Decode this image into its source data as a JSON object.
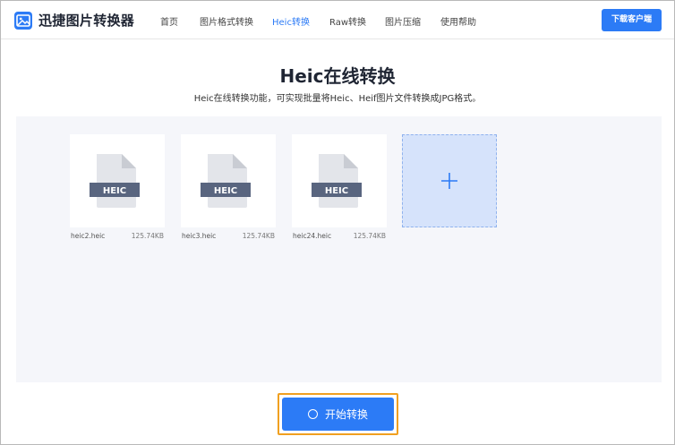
{
  "app": {
    "logo_text": "迅捷图片转换器",
    "brand_color": "#2c7bf6"
  },
  "nav": {
    "items": [
      {
        "label": "首页",
        "active": false
      },
      {
        "label": "图片格式转换",
        "active": false
      },
      {
        "label": "Heic转换",
        "active": true
      },
      {
        "label": "Raw转换",
        "active": false
      },
      {
        "label": "图片压缩",
        "active": false
      },
      {
        "label": "使用帮助",
        "active": false
      }
    ],
    "download_button": "下载客户端"
  },
  "page": {
    "title": "Heic在线转换",
    "subtitle": "Heic在线转换功能，可实现批量将Heic、Heif图片文件转换成JPG格式。"
  },
  "files": [
    {
      "name": "heic2.heic",
      "size": "125.74KB",
      "badge": "HEIC"
    },
    {
      "name": "heic3.heic",
      "size": "125.74KB",
      "badge": "HEIC"
    },
    {
      "name": "heic24.heic",
      "size": "125.74KB",
      "badge": "HEIC"
    }
  ],
  "add_tile": {
    "icon": "plus-icon"
  },
  "convert_button": {
    "label": "开始转换",
    "icon": "spinner-icon"
  }
}
